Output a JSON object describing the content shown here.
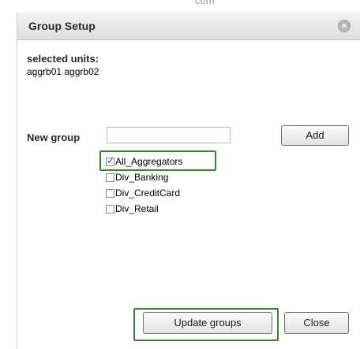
{
  "background": {
    "partial_text": "com"
  },
  "dialog": {
    "title": "Group Setup",
    "close_icon": "close-icon",
    "selected_units_label": "selected units:",
    "selected_units_value": "aggrb01 aggrb02",
    "new_group_label": "New group",
    "new_group_value": "",
    "add_button": "Add",
    "groups": [
      {
        "label": "All_Aggregators",
        "checked": true
      },
      {
        "label": "Div_Banking",
        "checked": false
      },
      {
        "label": "Div_CreditCard",
        "checked": false
      },
      {
        "label": "Div_Retail",
        "checked": false
      }
    ],
    "update_button": "Update groups",
    "close_button": "Close"
  },
  "colors": {
    "highlight": "#2f8a2a",
    "checkmark": "#1e4fb8"
  }
}
